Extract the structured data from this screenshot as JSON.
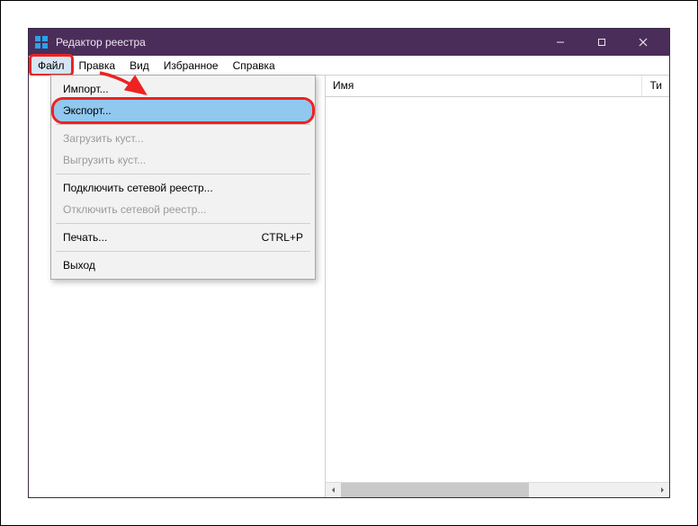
{
  "window": {
    "title": "Редактор реестра"
  },
  "menubar": {
    "items": [
      {
        "label": "Файл",
        "active": true
      },
      {
        "label": "Правка"
      },
      {
        "label": "Вид"
      },
      {
        "label": "Избранное"
      },
      {
        "label": "Справка"
      }
    ]
  },
  "file_menu": {
    "import": "Импорт...",
    "export": "Экспорт...",
    "load_hive": "Загрузить куст...",
    "unload_hive": "Выгрузить куст...",
    "connect_network": "Подключить сетевой реестр...",
    "disconnect_network": "Отключить сетевой реестр...",
    "print": "Печать...",
    "print_accel": "CTRL+P",
    "exit": "Выход"
  },
  "list": {
    "col_name": "Имя",
    "col_type": "Ти"
  }
}
